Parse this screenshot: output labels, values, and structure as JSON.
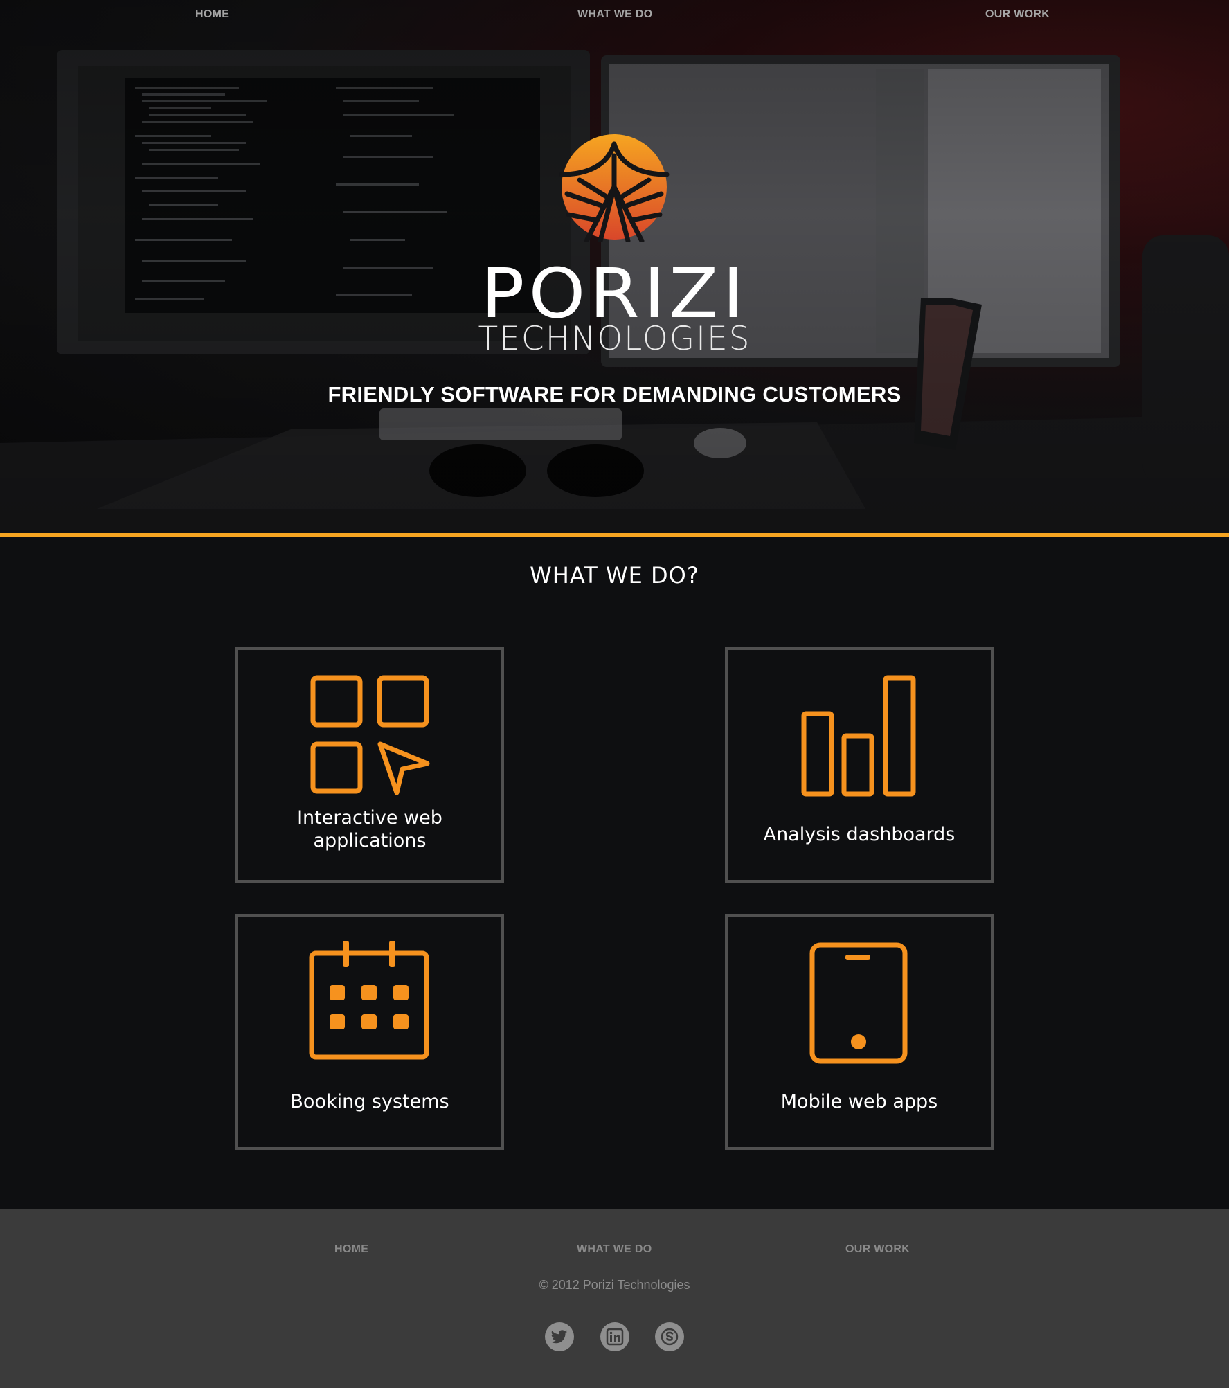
{
  "nav": {
    "home": "HOME",
    "what_we_do": "WHAT WE DO",
    "our_work": "OUR WORK"
  },
  "hero": {
    "brand_name": "PORIZI",
    "brand_sub": "TECHNOLOGIES",
    "tagline": "FRIENDLY SOFTWARE FOR DEMANDING CUSTOMERS",
    "accent_color": "#f6a521"
  },
  "services": {
    "title": "WHAT WE DO?",
    "items": [
      {
        "label": "Interactive web applications",
        "icon": "apps-grid-cursor-icon"
      },
      {
        "label": "Analysis dashboards",
        "icon": "bar-chart-icon"
      },
      {
        "label": "Booking systems",
        "icon": "calendar-icon"
      },
      {
        "label": "Mobile web apps",
        "icon": "tablet-icon"
      }
    ],
    "icon_color": "#f6921e"
  },
  "footer": {
    "nav": {
      "home": "HOME",
      "what_we_do": "WHAT WE DO",
      "our_work": "OUR WORK"
    },
    "copyright": "© 2012 Porizi Technologies",
    "social": [
      "twitter-icon",
      "linkedin-icon",
      "skype-icon"
    ]
  }
}
